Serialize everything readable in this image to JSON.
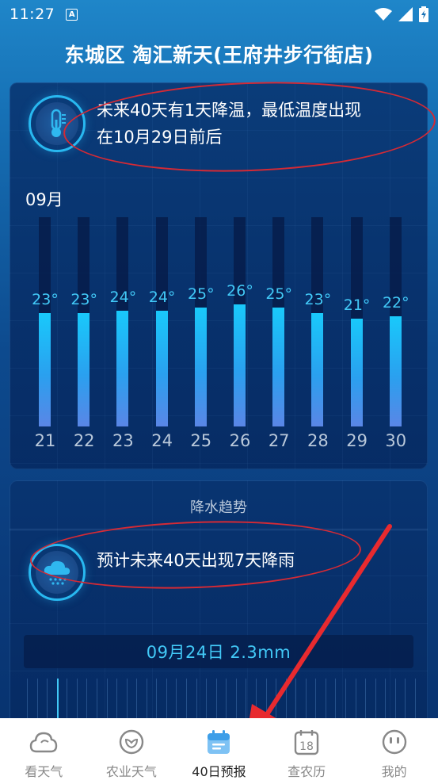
{
  "status": {
    "time": "11:27",
    "notif": "A"
  },
  "header": {
    "title": "东城区 淘汇新天(王府井步行街店)"
  },
  "temperature_card": {
    "summary_line1": "未来40天有1天降温，最低温度出现",
    "summary_line2": "在10月29日前后",
    "month": "09月",
    "chart_data": {
      "type": "bar",
      "categories": [
        "21",
        "22",
        "23",
        "24",
        "25",
        "26",
        "27",
        "28",
        "29",
        "30"
      ],
      "values": [
        23,
        23,
        24,
        24,
        25,
        26,
        25,
        23,
        21,
        22
      ],
      "value_labels": [
        "23°",
        "23°",
        "24°",
        "24°",
        "25°",
        "26°",
        "25°",
        "23°",
        "21°",
        "22°"
      ],
      "title": "",
      "xlabel": "",
      "ylabel": ""
    }
  },
  "rain_card": {
    "title": "降水趋势",
    "summary": "预计未来40天出现7天降雨",
    "selected_info": "09月24日 2.3mm"
  },
  "tabbar": {
    "items": [
      {
        "label": "看天气",
        "icon": "cloud-icon"
      },
      {
        "label": "农业天气",
        "icon": "leaf-icon"
      },
      {
        "label": "40日预报",
        "icon": "calendar-icon"
      },
      {
        "label": "查农历",
        "icon": "calendar-18-icon",
        "icon_text": "18"
      },
      {
        "label": "我的",
        "icon": "face-icon"
      }
    ],
    "active_index": 2
  },
  "colors": {
    "accent": "#42c9f7",
    "annotation_red": "#d42a35",
    "bar_gradient_top": "#19c9fb",
    "bar_gradient_bottom": "#5a86e6"
  }
}
